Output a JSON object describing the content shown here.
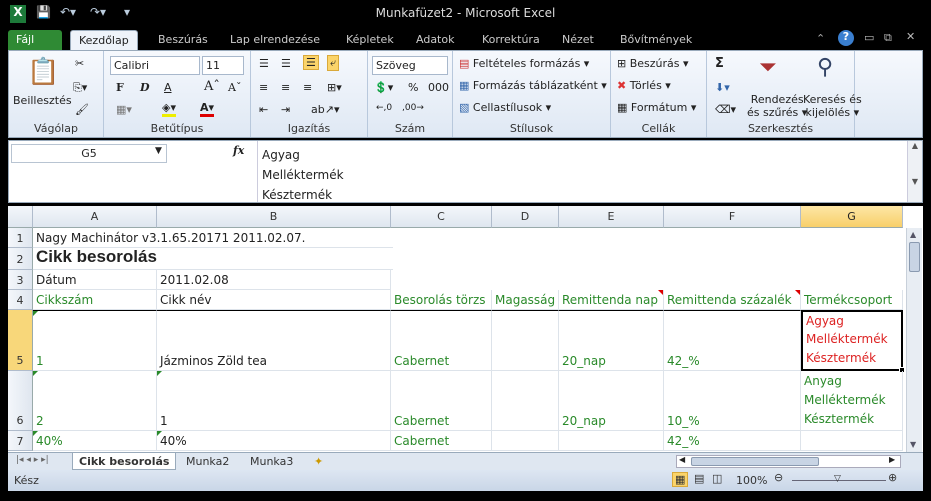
{
  "window": {
    "title": "Munkafüzet2  -  Microsoft Excel"
  },
  "tabs": [
    "Fájl",
    "Kezdőlap",
    "Beszúrás",
    "Lap elrendezése",
    "Képletek",
    "Adatok",
    "Korrektúra",
    "Nézet",
    "Bővítmények"
  ],
  "ribbon": {
    "clipboard": {
      "paste": "Beillesztés",
      "label": "Vágólap"
    },
    "font": {
      "name": "Calibri",
      "size": "11",
      "bold": "F",
      "italic": "D",
      "underline": "A",
      "label": "Betűtípus"
    },
    "alignment": {
      "label": "Igazítás"
    },
    "number": {
      "format": "Szöveg",
      "percent": "%",
      "thousands": "000",
      "label": "Szám"
    },
    "styles": {
      "conditional": "Feltételes formázás",
      "as_table": "Formázás táblázatként",
      "cell_styles": "Cellastílusok",
      "label": "Stílusok"
    },
    "cells": {
      "insert": "Beszúrás",
      "delete": "Törlés",
      "format": "Formátum",
      "label": "Cellák"
    },
    "editing": {
      "sum": "Σ",
      "sort1": "Rendezés",
      "sort2": "és szűrés",
      "find1": "Keresés és",
      "find2": "kijelölés",
      "label": "Szerkesztés"
    }
  },
  "formula_bar": {
    "name_box": "G5",
    "fx": "fx",
    "lines": [
      "Agyag",
      "Melléktermék",
      "Késztermék"
    ]
  },
  "columns": [
    "A",
    "B",
    "C",
    "D",
    "E",
    "F",
    "G"
  ],
  "rows": [
    "1",
    "2",
    "3",
    "4",
    "5",
    "6",
    "7"
  ],
  "cells": {
    "r1": {
      "A": "Nagy Machinátor v3.1.65.20171 2011.02.07."
    },
    "r2": {
      "A": "Cikk besorolás"
    },
    "r3": {
      "A": "Dátum",
      "B": "2011.02.08"
    },
    "r4": {
      "A": "Cikkszám",
      "B": "Cikk név",
      "C": "Besorolás törzs",
      "D": "Magasság",
      "E": "Remittenda nap",
      "F": "Remittenda százalék",
      "G": "Termékcsoport"
    },
    "r5": {
      "A": "1",
      "B": "Jázminos Zöld tea",
      "C": "Cabernet",
      "E": "20_nap",
      "F": "42_%",
      "G": [
        "Agyag",
        "Melléktermék",
        "Késztermék"
      ]
    },
    "r6": {
      "A": "2",
      "B": "1",
      "C": "Cabernet",
      "E": "20_nap",
      "F": "10_%",
      "G": [
        "Anyag",
        "Melléktermék",
        "Késztermék"
      ]
    },
    "r7": {
      "A": "40%",
      "B": "40%",
      "C": "Cabernet",
      "F": "42_%"
    }
  },
  "sheets": [
    "Cikk besorolás",
    "Munka2",
    "Munka3"
  ],
  "status": {
    "ready": "Kész",
    "zoom": "100%"
  }
}
